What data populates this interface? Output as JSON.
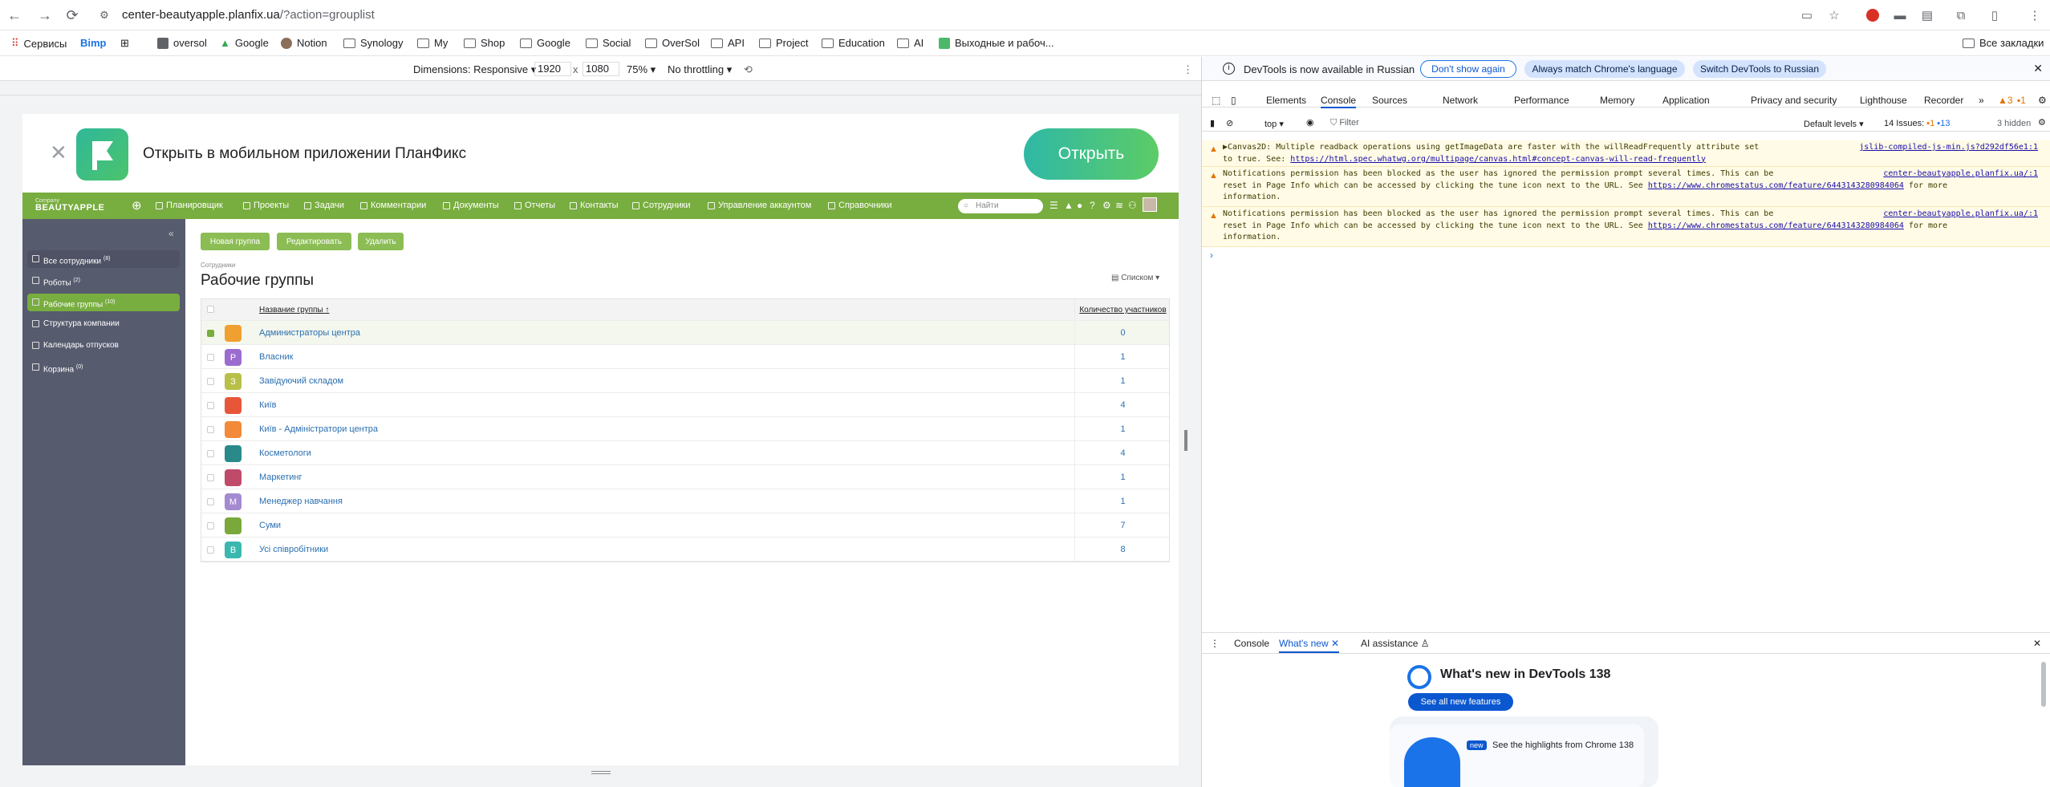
{
  "browser": {
    "url_host": "center-beautyapple.planfix.ua",
    "url_path": "/?action=grouplist",
    "bookmarks": [
      {
        "label": "Сервисы",
        "icon": "apps-icon"
      },
      {
        "label": "Bimp",
        "icon": "bimp-icon"
      },
      {
        "label": "",
        "icon": "grid-icon"
      },
      {
        "label": "oversol",
        "icon": "oversol-icon"
      },
      {
        "label": "Google",
        "icon": "google-icon"
      },
      {
        "label": "Notion",
        "icon": "notion-icon"
      },
      {
        "label": "Synology",
        "icon": "folder-icon"
      },
      {
        "label": "My",
        "icon": "folder-icon"
      },
      {
        "label": "Shop",
        "icon": "folder-icon"
      },
      {
        "label": "Google",
        "icon": "folder-icon"
      },
      {
        "label": "Social",
        "icon": "folder-icon"
      },
      {
        "label": "OverSol",
        "icon": "folder-icon"
      },
      {
        "label": "API",
        "icon": "folder-icon"
      },
      {
        "label": "Project",
        "icon": "folder-icon"
      },
      {
        "label": "Education",
        "icon": "folder-icon"
      },
      {
        "label": "AI",
        "icon": "folder-icon"
      },
      {
        "label": "Выходные и рабоч...",
        "icon": "planfix-icon"
      }
    ],
    "all_bookmarks": "Все закладки"
  },
  "device_toolbar": {
    "dimensions_label": "Dimensions: Responsive",
    "width": "1920",
    "x": "x",
    "height": "1080",
    "zoom": "75%",
    "throttle": "No throttling"
  },
  "planfix": {
    "banner": {
      "title": "Открыть в мобильном приложении ПланФикс",
      "open": "Открыть"
    },
    "brand_small": "Company",
    "brand": "BEAUTYAPPLE",
    "nav": [
      "Планировщик",
      "Проекты",
      "Задачи",
      "Комментарии",
      "Документы",
      "Отчеты",
      "Контакты",
      "Сотрудники",
      "Управление аккаунтом",
      "Справочники"
    ],
    "search_placeholder": "Найти",
    "sidebar": [
      {
        "label": "Все сотрудники",
        "count": "(8)"
      },
      {
        "label": "Роботы",
        "count": "(2)"
      },
      {
        "label": "Рабочие группы",
        "count": "(10)"
      },
      {
        "label": "Структура компании",
        "count": ""
      },
      {
        "label": "Календарь отпусков",
        "count": ""
      },
      {
        "label": "Корзина",
        "count": "(0)"
      }
    ],
    "buttons": {
      "new_group": "Новая группа",
      "edit": "Редактировать",
      "delete": "Удалить"
    },
    "breadcrumb": "Сотрудники",
    "title": "Рабочие группы",
    "view": "Списком",
    "table": {
      "col_name": "Название группы",
      "sort_arrow": "↑",
      "col_count": "Количество участников",
      "rows": [
        {
          "name": "Администраторы центра",
          "count": "0",
          "avatar_letter": "",
          "color": "#f0a030"
        },
        {
          "name": "Власник",
          "count": "1",
          "avatar_letter": "P",
          "color": "#9b6ccf"
        },
        {
          "name": "Завідуючий складом",
          "count": "1",
          "avatar_letter": "З",
          "color": "#b8c04a"
        },
        {
          "name": "Київ",
          "count": "4",
          "avatar_letter": "",
          "color": "#e8563a"
        },
        {
          "name": "Київ - Адміністратори центра",
          "count": "1",
          "avatar_letter": "",
          "color": "#f28a3a"
        },
        {
          "name": "Косметологи",
          "count": "4",
          "avatar_letter": "",
          "color": "#2a8a8a"
        },
        {
          "name": "Маркетинг",
          "count": "1",
          "avatar_letter": "",
          "color": "#c04a6a"
        },
        {
          "name": "Менеджер навчання",
          "count": "1",
          "avatar_letter": "M",
          "color": "#a48ad0"
        },
        {
          "name": "Суми",
          "count": "7",
          "avatar_letter": "",
          "color": "#7aa83a"
        },
        {
          "name": "Усі співробітники",
          "count": "8",
          "avatar_letter": "B",
          "color": "#3ab8b0"
        }
      ]
    }
  },
  "devtools": {
    "notice": "DevTools is now available in Russian",
    "dont_show": "Don't show again",
    "match_lang": "Always match Chrome's language",
    "switch": "Switch DevTools to Russian",
    "tabs": [
      "Elements",
      "Console",
      "Sources",
      "Network",
      "Performance",
      "Memory",
      "Application",
      "Privacy and security",
      "Lighthouse",
      "Recorder"
    ],
    "more_tabs": "»",
    "badge_warn": "3",
    "badge_info": "1",
    "console_bar": {
      "context": "top",
      "filter_placeholder": "Filter",
      "levels": "Default levels",
      "issues_label": "14 Issues:",
      "issues_warn": "1",
      "issues_info": "13",
      "hidden": "3 hidden"
    },
    "messages": [
      {
        "line1_pre": "▶Canvas2D: Multiple readback operations using getImageData are faster with the willReadFrequently attribute set",
        "line2_pre": "to true. See: ",
        "link": "https://html.spec.whatwg.org/multipage/canvas.html#concept-canvas-will-read-frequently",
        "source": "jslib-compiled-js-min.js?d292df56e1:1"
      },
      {
        "line1_pre": "Notifications permission has been blocked as the user has ignored the permission prompt several times. This can be",
        "line2_pre": "reset in Page Info which can be accessed by clicking the tune icon next to the URL. See ",
        "link": "https://www.chromestatus.com/feature/6443143280984064",
        "line2_post": " for more",
        "line3": "information.",
        "source": "center-beautyapple.planfix.ua/:1"
      },
      {
        "line1_pre": "Notifications permission has been blocked as the user has ignored the permission prompt several times. This can be",
        "line2_pre": "reset in Page Info which can be accessed by clicking the tune icon next to the URL. See ",
        "link": "https://www.chromestatus.com/feature/6443143280984064",
        "line2_post": " for more",
        "line3": "information.",
        "source": "center-beautyapple.planfix.ua/:1"
      }
    ],
    "prompt": "›",
    "drawer": {
      "tabs": [
        "Console",
        "What's new",
        "AI assistance"
      ],
      "title": "What's new in DevTools 138",
      "see_all": "See all new features",
      "highlight": "See the highlights from Chrome 138",
      "new_badge": "new"
    }
  }
}
